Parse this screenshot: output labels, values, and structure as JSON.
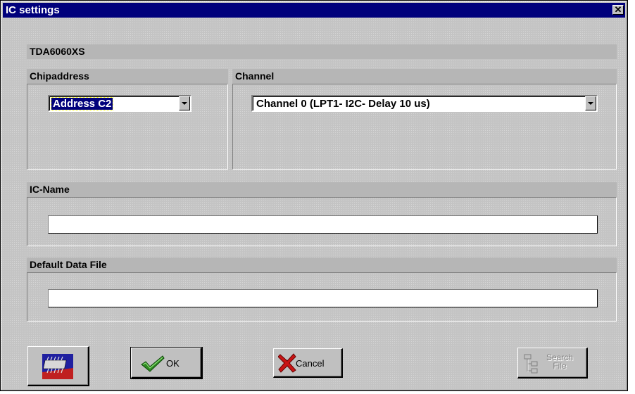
{
  "window": {
    "title": "IC settings",
    "close_glyph": "✕"
  },
  "chip_name": "TDA6060XS",
  "chipaddress": {
    "label": "Chipaddress",
    "selected": "Address C2"
  },
  "channel": {
    "label": "Channel",
    "selected": "Channel 0 (LPT1- I2C- Delay 10 us)"
  },
  "ic_name": {
    "label": "IC-Name",
    "value": ""
  },
  "default_data_file": {
    "label": "Default Data File",
    "value": ""
  },
  "buttons": {
    "chip_icon": "chip-icon",
    "ok": "OK",
    "cancel": "Cancel",
    "search_file_line1": "Search",
    "search_file_line2": "File"
  },
  "colors": {
    "titlebar": "#00007c",
    "face": "#c0c0c0",
    "selection": "#00007c"
  }
}
